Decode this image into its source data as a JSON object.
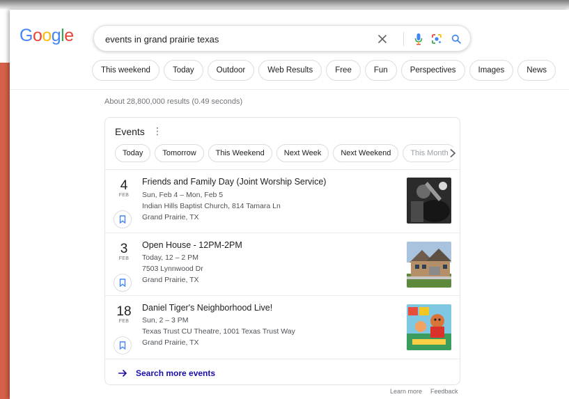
{
  "logo": [
    "G",
    "o",
    "o",
    "g",
    "l",
    "e"
  ],
  "logo_colors": [
    "#4285f4",
    "#ea4335",
    "#fbbc05",
    "#4285f4",
    "#34a853",
    "#ea4335"
  ],
  "search": {
    "value": "events in grand prairie texas",
    "icons": [
      "close-icon",
      "microphone-icon",
      "lens-icon",
      "search-icon"
    ]
  },
  "chips": [
    "This weekend",
    "Today",
    "Outdoor",
    "Web Results",
    "Free",
    "Fun",
    "Perspectives",
    "Images",
    "News"
  ],
  "result_stats": "About 28,800,000 results (0.49 seconds)",
  "events_card": {
    "title": "Events",
    "menu_icon": "⋮",
    "filters": [
      "Today",
      "Tomorrow",
      "This Weekend",
      "Next Week",
      "Next Weekend",
      "This Month"
    ],
    "items": [
      {
        "day": "4",
        "month": "FEB",
        "title": "Friends and Family Day (Joint Worship Service)",
        "when": "Sun, Feb 4 – Mon, Feb 5",
        "venue": "Indian Hills Baptist Church, 814 Tamara Ln",
        "city": "Grand Prairie, TX"
      },
      {
        "day": "3",
        "month": "FEB",
        "title": "Open House - 12PM-2PM",
        "when": "Today, 12 – 2 PM",
        "venue": "7503 Lynnwood Dr",
        "city": "Grand Prairie, TX"
      },
      {
        "day": "18",
        "month": "FEB",
        "title": "Daniel Tiger's Neighborhood Live!",
        "when": "Sun, 2 – 3 PM",
        "venue": "Texas Trust CU Theatre, 1001 Texas Trust Way",
        "city": "Grand Prairie, TX"
      }
    ],
    "more_label": "Search more events"
  },
  "footer": {
    "learn_more": "Learn more",
    "feedback": "Feedback"
  },
  "colors": {
    "link_blue": "#1a0dab",
    "accent_blue": "#4285f4",
    "border_accent": "#d5614a"
  }
}
